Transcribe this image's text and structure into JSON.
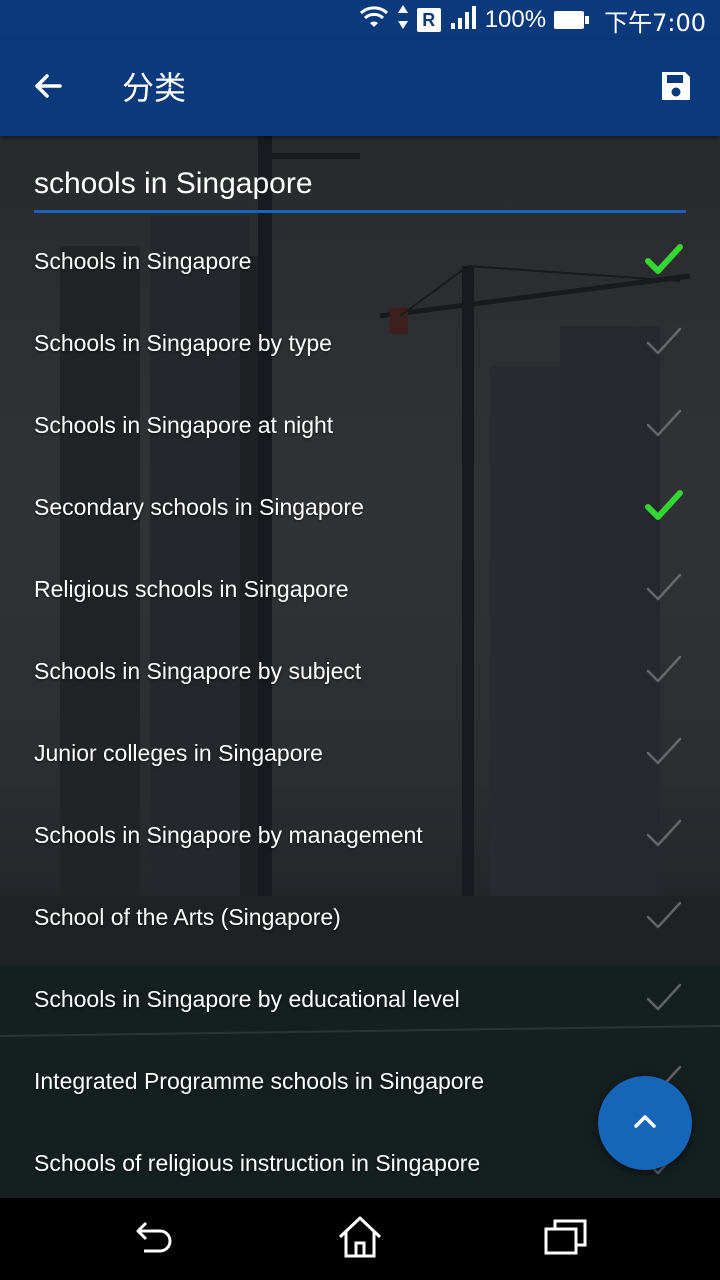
{
  "status_bar": {
    "roaming_badge": "R",
    "battery": "100%",
    "time": "下午7:00",
    "icons": [
      "wifi-icon",
      "data-arrows-icon",
      "roaming-icon",
      "signal-icon",
      "battery-icon"
    ]
  },
  "app_bar": {
    "title": "分类",
    "back_icon": "arrow-left-icon",
    "save_icon": "save-icon"
  },
  "search": {
    "value": "schools in Singapore",
    "accent_color": "#1565c0"
  },
  "categories": [
    {
      "label": "Schools in Singapore",
      "checked": true
    },
    {
      "label": "Schools in Singapore by type",
      "checked": false
    },
    {
      "label": "Schools in Singapore at night",
      "checked": false
    },
    {
      "label": "Secondary schools in Singapore",
      "checked": true
    },
    {
      "label": "Religious schools in Singapore",
      "checked": false
    },
    {
      "label": "Schools in Singapore by subject",
      "checked": false
    },
    {
      "label": "Junior colleges in Singapore",
      "checked": false
    },
    {
      "label": "Schools in Singapore by management",
      "checked": false
    },
    {
      "label": "School of the Arts (Singapore)",
      "checked": false
    },
    {
      "label": "Schools in Singapore by educational level",
      "checked": false
    },
    {
      "label": "Integrated Programme schools in Singapore",
      "checked": false
    },
    {
      "label": "Schools of religious instruction in Singapore",
      "checked": false
    }
  ],
  "fab": {
    "icon": "chevron-up-icon"
  },
  "nav_bar": {
    "icons": [
      "back-nav-icon",
      "home-nav-icon",
      "recents-nav-icon"
    ]
  },
  "colors": {
    "primary": "#0a3a7c",
    "check_on": "#33d633",
    "check_off": "#7a7c80",
    "fab": "#1565b8"
  }
}
